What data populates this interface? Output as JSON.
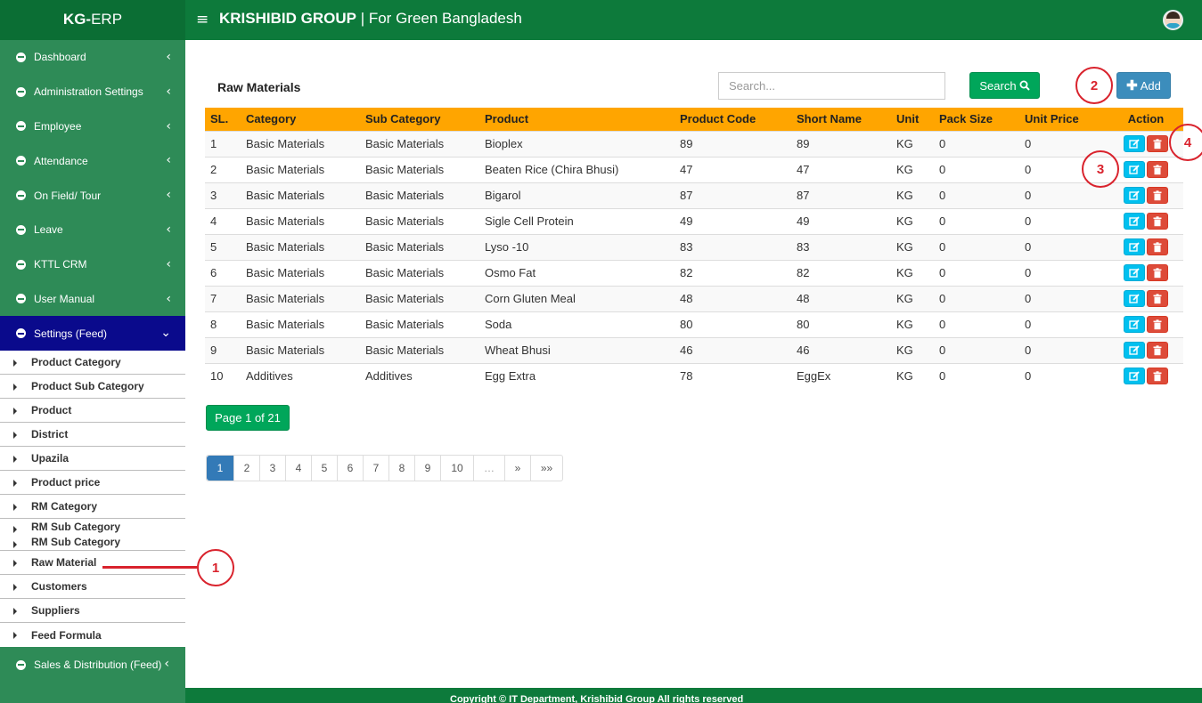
{
  "brand": {
    "bold": "KG-",
    "rest": "ERP"
  },
  "header": {
    "company": "KRISHIBID GROUP",
    "separator": " | ",
    "tagline": "For Green Bangladesh",
    "menu_icon": "≡"
  },
  "sidebar": {
    "items": [
      {
        "label": "Dashboard",
        "chevron": "‹"
      },
      {
        "label": "Administration Settings",
        "chevron": "‹"
      },
      {
        "label": "Employee",
        "chevron": "‹"
      },
      {
        "label": "Attendance",
        "chevron": "‹"
      },
      {
        "label": "On Field/ Tour",
        "chevron": "‹"
      },
      {
        "label": "Leave",
        "chevron": "‹"
      },
      {
        "label": "KTTL CRM",
        "chevron": "‹"
      },
      {
        "label": "User Manual",
        "chevron": "‹"
      },
      {
        "label": "Settings (Feed)",
        "chevron": "⌄"
      }
    ],
    "submenu": [
      "Product Category",
      "Product Sub Category",
      "Product",
      "District",
      "Upazila",
      "Product price",
      "RM Category",
      "RM Sub Category",
      "RM Sub Category",
      "Raw Material",
      "Customers",
      "Suppliers",
      "Feed Formula"
    ],
    "last_item": {
      "label": "Sales & Distribution (Feed)",
      "chevron": "‹"
    }
  },
  "main": {
    "title": "Raw Materials",
    "search_placeholder": "Search...",
    "search_button": "Search",
    "add_button": "Add"
  },
  "table": {
    "headers": [
      "SL.",
      "Category",
      "Sub Category",
      "Product",
      "Product Code",
      "Short Name",
      "Unit",
      "Pack Size",
      "Unit Price",
      "Action"
    ],
    "rows": [
      [
        "1",
        "Basic Materials",
        "Basic Materials",
        "Bioplex",
        "89",
        "89",
        "KG",
        "0",
        "0"
      ],
      [
        "2",
        "Basic Materials",
        "Basic Materials",
        "Beaten Rice (Chira Bhusi)",
        "47",
        "47",
        "KG",
        "0",
        "0"
      ],
      [
        "3",
        "Basic Materials",
        "Basic Materials",
        "Bigarol",
        "87",
        "87",
        "KG",
        "0",
        "0"
      ],
      [
        "4",
        "Basic Materials",
        "Basic Materials",
        "Sigle Cell Protein",
        "49",
        "49",
        "KG",
        "0",
        "0"
      ],
      [
        "5",
        "Basic Materials",
        "Basic Materials",
        "Lyso -10",
        "83",
        "83",
        "KG",
        "0",
        "0"
      ],
      [
        "6",
        "Basic Materials",
        "Basic Materials",
        "Osmo Fat",
        "82",
        "82",
        "KG",
        "0",
        "0"
      ],
      [
        "7",
        "Basic Materials",
        "Basic Materials",
        "Corn Gluten Meal",
        "48",
        "48",
        "KG",
        "0",
        "0"
      ],
      [
        "8",
        "Basic Materials",
        "Basic Materials",
        "Soda",
        "80",
        "80",
        "KG",
        "0",
        "0"
      ],
      [
        "9",
        "Basic Materials",
        "Basic Materials",
        "Wheat Bhusi",
        "46",
        "46",
        "KG",
        "0",
        "0"
      ],
      [
        "10",
        "Additives",
        "Additives",
        "Egg Extra",
        "78",
        "EggEx",
        "KG",
        "0",
        "0"
      ]
    ]
  },
  "pagination": {
    "summary": "Page 1 of 21",
    "pages": [
      "1",
      "2",
      "3",
      "4",
      "5",
      "6",
      "7",
      "8",
      "9",
      "10",
      "…",
      "»",
      "»»"
    ],
    "current": "1"
  },
  "footer": {
    "text": "Copyright © IT Department, Krishibid Group All rights reserved"
  },
  "annotations": [
    "1",
    "2",
    "3",
    "4"
  ],
  "colors": {
    "header": "#0d7a3b",
    "sidebar": "#2e8b57",
    "active_menu": "#0a0a8c",
    "table_header": "#ffa500",
    "annotation": "#d9232d"
  }
}
